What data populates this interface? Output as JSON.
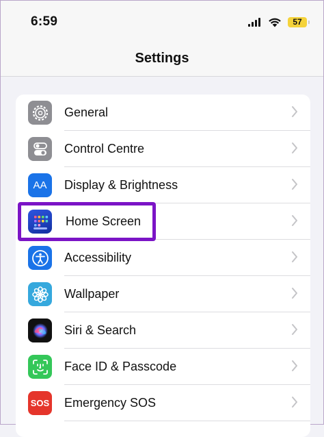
{
  "status": {
    "time": "6:59",
    "battery": "57"
  },
  "header": {
    "title": "Settings"
  },
  "settings": {
    "items": [
      {
        "label": "General",
        "icon": "gear-icon",
        "color": "#8e8e93"
      },
      {
        "label": "Control Centre",
        "icon": "toggles-icon",
        "color": "#8e8e93"
      },
      {
        "label": "Display & Brightness",
        "icon": "text-size-icon",
        "color": "#1a73e8",
        "icon_text": "AA"
      },
      {
        "label": "Home Screen",
        "icon": "app-grid-icon",
        "color": "#1c3fb8"
      },
      {
        "label": "Accessibility",
        "icon": "accessibility-icon",
        "color": "#1a73e8"
      },
      {
        "label": "Wallpaper",
        "icon": "flower-icon",
        "color": "#35a8dd"
      },
      {
        "label": "Siri & Search",
        "icon": "siri-icon",
        "color": "#111111"
      },
      {
        "label": "Face ID & Passcode",
        "icon": "face-id-icon",
        "color": "#34c759"
      },
      {
        "label": "Emergency SOS",
        "icon": "sos-icon",
        "color": "#e5352b",
        "icon_text": "SOS"
      }
    ]
  },
  "colors": {
    "highlight": "#7b14c6",
    "background": "#f2f2f7"
  }
}
